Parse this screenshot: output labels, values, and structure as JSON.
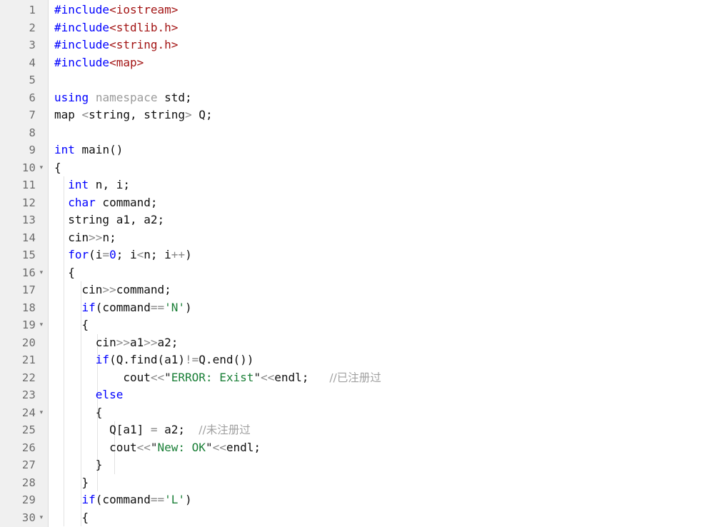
{
  "editor": {
    "language": "C++",
    "total_lines_visible": 30,
    "background_color": "#ffffff",
    "gutter_color": "#f0f0f0",
    "fold_marker_glyph": "▾",
    "colors": {
      "keyword": "#0000ff",
      "preprocessor": "#0000ff",
      "header_name": "#a31515",
      "string": "#1a7f37",
      "comment": "#a0a0a0",
      "operator": "#8a8a8a",
      "plain_text": "#101010",
      "line_number": "#6b6b6b",
      "indent_guide": "#e2e2e2"
    }
  },
  "lines": [
    {
      "num": "1",
      "fold": false,
      "indent_guides": 0,
      "tokens": [
        {
          "t": "#include",
          "c": "inc"
        },
        {
          "t": "<iostream>",
          "c": "hdr"
        }
      ]
    },
    {
      "num": "2",
      "fold": false,
      "indent_guides": 0,
      "tokens": [
        {
          "t": "#include",
          "c": "inc"
        },
        {
          "t": "<stdlib.h>",
          "c": "hdr"
        }
      ]
    },
    {
      "num": "3",
      "fold": false,
      "indent_guides": 0,
      "tokens": [
        {
          "t": "#include",
          "c": "inc"
        },
        {
          "t": "<string.h>",
          "c": "hdr"
        }
      ]
    },
    {
      "num": "4",
      "fold": false,
      "indent_guides": 0,
      "tokens": [
        {
          "t": "#include",
          "c": "inc"
        },
        {
          "t": "<map>",
          "c": "hdr"
        }
      ]
    },
    {
      "num": "5",
      "fold": false,
      "indent_guides": 0,
      "tokens": []
    },
    {
      "num": "6",
      "fold": false,
      "indent_guides": 0,
      "tokens": [
        {
          "t": "using",
          "c": "kw"
        },
        {
          "t": " ",
          "c": "plain"
        },
        {
          "t": "namespace",
          "c": "dim"
        },
        {
          "t": " std;",
          "c": "plain"
        }
      ]
    },
    {
      "num": "7",
      "fold": false,
      "indent_guides": 0,
      "tokens": [
        {
          "t": "map ",
          "c": "plain"
        },
        {
          "t": "<",
          "c": "op"
        },
        {
          "t": "string, string",
          "c": "plain"
        },
        {
          "t": ">",
          "c": "op"
        },
        {
          "t": " Q;",
          "c": "plain"
        }
      ]
    },
    {
      "num": "8",
      "fold": false,
      "indent_guides": 0,
      "tokens": []
    },
    {
      "num": "9",
      "fold": false,
      "indent_guides": 0,
      "tokens": [
        {
          "t": "int",
          "c": "kw"
        },
        {
          "t": " main()",
          "c": "plain"
        }
      ]
    },
    {
      "num": "10",
      "fold": true,
      "indent_guides": 0,
      "tokens": [
        {
          "t": "{",
          "c": "plain"
        }
      ]
    },
    {
      "num": "11",
      "fold": false,
      "indent_guides": 1,
      "tokens": [
        {
          "t": "  ",
          "c": "plain"
        },
        {
          "t": "int",
          "c": "kw"
        },
        {
          "t": " n, i;",
          "c": "plain"
        }
      ]
    },
    {
      "num": "12",
      "fold": false,
      "indent_guides": 1,
      "tokens": [
        {
          "t": "  ",
          "c": "plain"
        },
        {
          "t": "char",
          "c": "kw"
        },
        {
          "t": " command;",
          "c": "plain"
        }
      ]
    },
    {
      "num": "13",
      "fold": false,
      "indent_guides": 1,
      "tokens": [
        {
          "t": "  string a1, a2;",
          "c": "plain"
        }
      ]
    },
    {
      "num": "14",
      "fold": false,
      "indent_guides": 1,
      "tokens": [
        {
          "t": "  cin",
          "c": "plain"
        },
        {
          "t": ">>",
          "c": "op"
        },
        {
          "t": "n;",
          "c": "plain"
        }
      ]
    },
    {
      "num": "15",
      "fold": false,
      "indent_guides": 1,
      "tokens": [
        {
          "t": "  ",
          "c": "plain"
        },
        {
          "t": "for",
          "c": "kw"
        },
        {
          "t": "(i",
          "c": "plain"
        },
        {
          "t": "=",
          "c": "op"
        },
        {
          "t": "0",
          "c": "num"
        },
        {
          "t": "; i",
          "c": "plain"
        },
        {
          "t": "<",
          "c": "op"
        },
        {
          "t": "n; i",
          "c": "plain"
        },
        {
          "t": "++",
          "c": "op"
        },
        {
          "t": ")",
          "c": "plain"
        }
      ]
    },
    {
      "num": "16",
      "fold": true,
      "indent_guides": 1,
      "tokens": [
        {
          "t": "  {",
          "c": "plain"
        }
      ]
    },
    {
      "num": "17",
      "fold": false,
      "indent_guides": 2,
      "tokens": [
        {
          "t": "    cin",
          "c": "plain"
        },
        {
          "t": ">>",
          "c": "op"
        },
        {
          "t": "command;",
          "c": "plain"
        }
      ]
    },
    {
      "num": "18",
      "fold": false,
      "indent_guides": 2,
      "tokens": [
        {
          "t": "    ",
          "c": "plain"
        },
        {
          "t": "if",
          "c": "kw"
        },
        {
          "t": "(command",
          "c": "plain"
        },
        {
          "t": "==",
          "c": "op"
        },
        {
          "t": "'N'",
          "c": "str"
        },
        {
          "t": ")",
          "c": "plain"
        }
      ]
    },
    {
      "num": "19",
      "fold": true,
      "indent_guides": 2,
      "tokens": [
        {
          "t": "    {",
          "c": "plain"
        }
      ]
    },
    {
      "num": "20",
      "fold": false,
      "indent_guides": 3,
      "tokens": [
        {
          "t": "      cin",
          "c": "plain"
        },
        {
          "t": ">>",
          "c": "op"
        },
        {
          "t": "a1",
          "c": "plain"
        },
        {
          "t": ">>",
          "c": "op"
        },
        {
          "t": "a2;",
          "c": "plain"
        }
      ]
    },
    {
      "num": "21",
      "fold": false,
      "indent_guides": 3,
      "tokens": [
        {
          "t": "      ",
          "c": "plain"
        },
        {
          "t": "if",
          "c": "kw"
        },
        {
          "t": "(Q.find(a1)",
          "c": "plain"
        },
        {
          "t": "!=",
          "c": "op"
        },
        {
          "t": "Q.end())",
          "c": "plain"
        }
      ]
    },
    {
      "num": "22",
      "fold": false,
      "indent_guides": 3,
      "tokens": [
        {
          "t": "          cout",
          "c": "plain"
        },
        {
          "t": "<<",
          "c": "op"
        },
        {
          "t": "\"",
          "c": "quote"
        },
        {
          "t": "ERROR: Exist",
          "c": "str"
        },
        {
          "t": "\"",
          "c": "quote"
        },
        {
          "t": "<<",
          "c": "op"
        },
        {
          "t": "endl;   ",
          "c": "plain"
        },
        {
          "t": "//已注册过",
          "c": "cmt-cjk"
        }
      ]
    },
    {
      "num": "23",
      "fold": false,
      "indent_guides": 3,
      "tokens": [
        {
          "t": "      ",
          "c": "plain"
        },
        {
          "t": "else",
          "c": "kw"
        }
      ]
    },
    {
      "num": "24",
      "fold": true,
      "indent_guides": 3,
      "tokens": [
        {
          "t": "      {",
          "c": "plain"
        }
      ]
    },
    {
      "num": "25",
      "fold": false,
      "indent_guides": 4,
      "tokens": [
        {
          "t": "        Q[a1] ",
          "c": "plain"
        },
        {
          "t": "=",
          "c": "op"
        },
        {
          "t": " a2;  ",
          "c": "plain"
        },
        {
          "t": "//未注册过",
          "c": "cmt-cjk"
        }
      ]
    },
    {
      "num": "26",
      "fold": false,
      "indent_guides": 4,
      "tokens": [
        {
          "t": "        cout",
          "c": "plain"
        },
        {
          "t": "<<",
          "c": "op"
        },
        {
          "t": "\"",
          "c": "quote"
        },
        {
          "t": "New: OK",
          "c": "str"
        },
        {
          "t": "\"",
          "c": "quote"
        },
        {
          "t": "<<",
          "c": "op"
        },
        {
          "t": "endl;",
          "c": "plain"
        }
      ]
    },
    {
      "num": "27",
      "fold": false,
      "indent_guides": 4,
      "tokens": [
        {
          "t": "      }",
          "c": "plain"
        }
      ]
    },
    {
      "num": "28",
      "fold": false,
      "indent_guides": 3,
      "tokens": [
        {
          "t": "    }",
          "c": "plain"
        }
      ]
    },
    {
      "num": "29",
      "fold": false,
      "indent_guides": 2,
      "tokens": [
        {
          "t": "    ",
          "c": "plain"
        },
        {
          "t": "if",
          "c": "kw"
        },
        {
          "t": "(command",
          "c": "plain"
        },
        {
          "t": "==",
          "c": "op"
        },
        {
          "t": "'L'",
          "c": "str"
        },
        {
          "t": ")",
          "c": "plain"
        }
      ]
    },
    {
      "num": "30",
      "fold": true,
      "indent_guides": 2,
      "tokens": [
        {
          "t": "    {",
          "c": "plain"
        }
      ]
    }
  ]
}
